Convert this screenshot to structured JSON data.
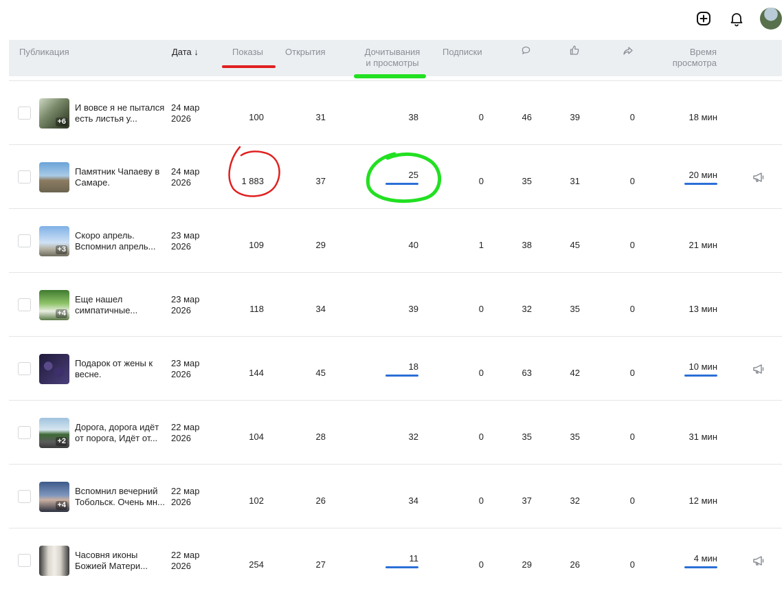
{
  "header": {
    "publication": "Публикация",
    "date": "Дата",
    "sort_arrow": "↓",
    "shows": "Показы",
    "opens": "Открытия",
    "reads_line1": "Дочитывания",
    "reads_line2": "и просмотры",
    "subscriptions": "Подписки",
    "comments_icon": "comment-icon",
    "likes_icon": "like-icon",
    "shares_icon": "share-icon",
    "time_line1": "Время",
    "time_line2": "просмотра"
  },
  "top_icons": [
    "plus-square-icon",
    "bell-icon",
    "avatar"
  ],
  "accent": {
    "red": "#e02020",
    "green": "#22e022",
    "blue": "#2a6fd6"
  },
  "rows": [
    {
      "title1": "И вовсе я не пытался",
      "title2": "есть листья у...",
      "date1": "24 мар",
      "date2": "2026",
      "plus": "+6",
      "shows": "100",
      "opens": "31",
      "reads": "38",
      "subs": "0",
      "comments": "46",
      "likes": "39",
      "shares": "0",
      "time": "18 мин",
      "promo": false,
      "reads_bar": false,
      "thumb": "cat"
    },
    {
      "title1": "Памятник Чапаеву в",
      "title2": "Самаре.",
      "date1": "24 мар",
      "date2": "2026",
      "plus": "",
      "shows": "1 883",
      "opens": "37",
      "reads": "25",
      "subs": "0",
      "comments": "35",
      "likes": "31",
      "shares": "0",
      "time": "20 мин",
      "promo": true,
      "reads_bar": true,
      "thumb": "monument"
    },
    {
      "title1": "Скоро апрель.",
      "title2": "Вспомнил апрель...",
      "date1": "23 мар",
      "date2": "2026",
      "plus": "+3",
      "shows": "109",
      "opens": "29",
      "reads": "40",
      "subs": "1",
      "comments": "38",
      "likes": "45",
      "shares": "0",
      "time": "21 мин",
      "promo": false,
      "reads_bar": false,
      "thumb": "sky"
    },
    {
      "title1": "Еще нашел",
      "title2": "симпатичные...",
      "date1": "23 мар",
      "date2": "2026",
      "plus": "+4",
      "shows": "118",
      "opens": "34",
      "reads": "39",
      "subs": "0",
      "comments": "32",
      "likes": "35",
      "shares": "0",
      "time": "13 мин",
      "promo": false,
      "reads_bar": false,
      "thumb": "green"
    },
    {
      "title1": "Подарок от жены к",
      "title2": "весне.",
      "date1": "23 мар",
      "date2": "2026",
      "plus": "",
      "shows": "144",
      "opens": "45",
      "reads": "18",
      "subs": "0",
      "comments": "63",
      "likes": "42",
      "shares": "0",
      "time": "10 мин",
      "promo": true,
      "reads_bar": true,
      "thumb": "berries"
    },
    {
      "title1": "Дорога, дорога идёт",
      "title2": "от порога, Идёт от...",
      "date1": "22 мар",
      "date2": "2026",
      "plus": "+2",
      "shows": "104",
      "opens": "28",
      "reads": "32",
      "subs": "0",
      "comments": "35",
      "likes": "35",
      "shares": "0",
      "time": "31 мин",
      "promo": false,
      "reads_bar": false,
      "thumb": "road"
    },
    {
      "title1": "Вспомнил вечерний",
      "title2": "Тобольск. Очень мн...",
      "date1": "22 мар",
      "date2": "2026",
      "plus": "+4",
      "shows": "102",
      "opens": "26",
      "reads": "34",
      "subs": "0",
      "comments": "37",
      "likes": "32",
      "shares": "0",
      "time": "12 мин",
      "promo": false,
      "reads_bar": false,
      "thumb": "evening"
    },
    {
      "title1": "Часовня иконы",
      "title2": "Божией Матери...",
      "date1": "22 мар",
      "date2": "2026",
      "plus": "",
      "shows": "254",
      "opens": "27",
      "reads": "11",
      "subs": "0",
      "comments": "29",
      "likes": "26",
      "shares": "0",
      "time": "4 мин",
      "promo": true,
      "reads_bar": true,
      "thumb": "chapel"
    }
  ]
}
